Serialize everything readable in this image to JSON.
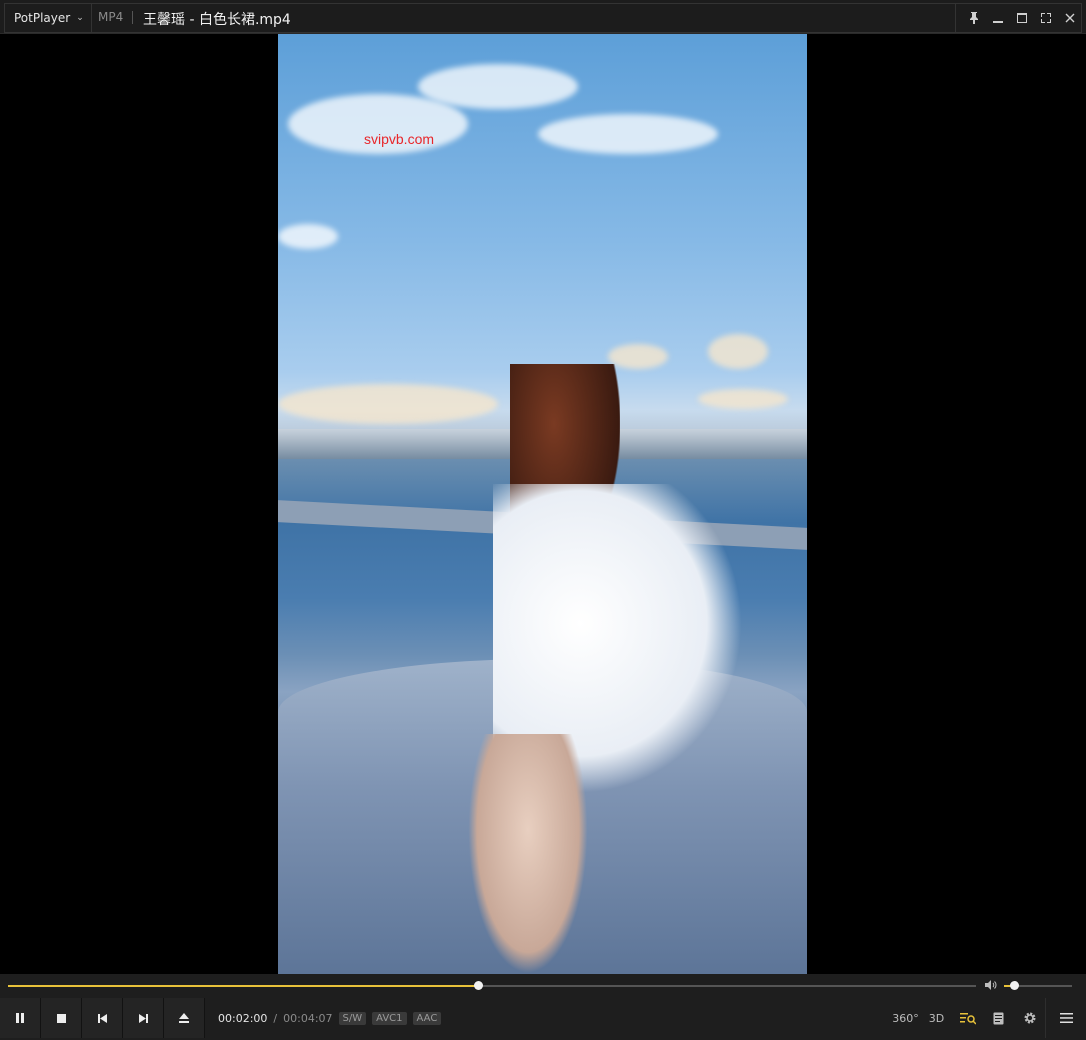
{
  "titlebar": {
    "app_name": "PotPlayer",
    "format": "MP4",
    "title": "王馨瑶 - 白色长裙.mp4"
  },
  "video": {
    "watermark": "svipvb.com"
  },
  "controls": {
    "current_time": "00:02:00",
    "separator": "/",
    "total_time": "00:04:07",
    "progress_fraction": 0.486,
    "volume_fraction": 0.15,
    "badges": [
      "S/W",
      "AVC1",
      "AAC"
    ],
    "btn_360": "360°",
    "btn_3d": "3D"
  },
  "colors": {
    "accent": "#e8c23a",
    "watermark": "#e8262a"
  }
}
